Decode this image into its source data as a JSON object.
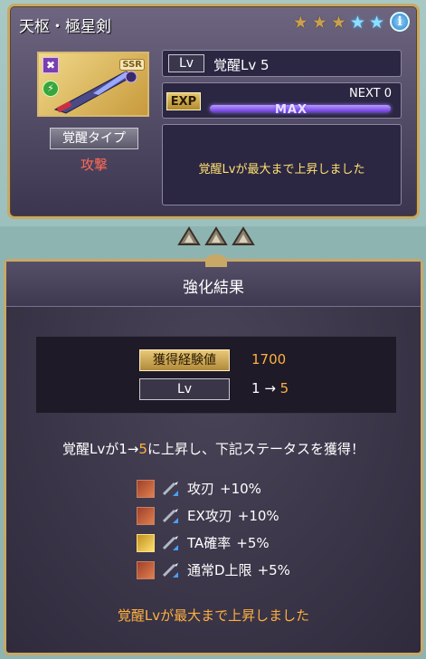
{
  "card": {
    "title": "天枢・極星剣",
    "stars": [
      "gold",
      "gold",
      "gold",
      "blue",
      "blue"
    ],
    "weapon_badge": "SSR",
    "element_glyph": "✖",
    "sub_glyph": "⚡",
    "type_label": "覚醒タイプ",
    "type_value": "攻撃",
    "lv_tag": "Lv",
    "lv_text": "覚醒Lv 5",
    "exp_tag": "EXP",
    "next_text": "NEXT 0",
    "max_text": "MAX",
    "message": "覚醒Lvが最大まで上昇しました"
  },
  "panel": {
    "title": "強化結果",
    "exp_label": "獲得経験値",
    "exp_value": "1700",
    "lv_label": "Lv",
    "lv_from": "1",
    "lv_arrow": " → ",
    "lv_to": "5",
    "summary_pre": "覚醒Lvが1→",
    "summary_hl": "5",
    "summary_post": "に上昇し、下記ステータスを獲得！",
    "bonuses": [
      {
        "name": "攻刃",
        "pct": "+10%",
        "icon": "attack-icon"
      },
      {
        "name": "EX攻刃",
        "pct": "+10%",
        "icon": "attack-icon"
      },
      {
        "name": "TA確率",
        "pct": "+5%",
        "icon": "triple-attack-icon"
      },
      {
        "name": "通常D上限",
        "pct": "+5%",
        "icon": "attack-icon"
      }
    ],
    "footer": "覚醒Lvが最大まで上昇しました"
  },
  "colors": {
    "accent": "#ffb040",
    "frame": "#c8a867",
    "bar": "#6a3ad8"
  }
}
